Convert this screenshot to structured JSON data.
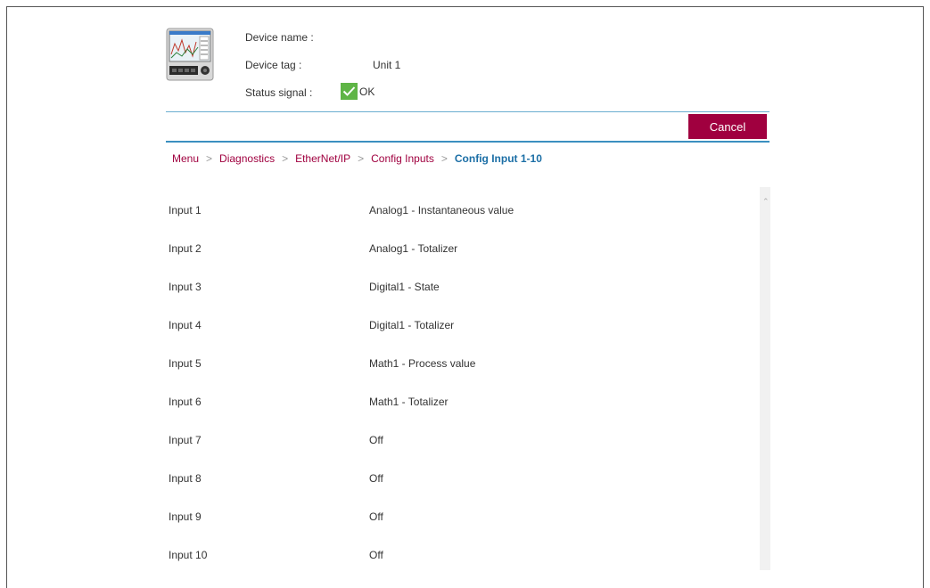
{
  "device": {
    "name_label": "Device name :",
    "name_value": "",
    "tag_label": "Device tag :",
    "tag_value": "Unit 1",
    "status_label": "Status signal :",
    "status_value": "OK",
    "status_color": "#5fb546"
  },
  "toolbar": {
    "cancel_label": "Cancel",
    "cancel_color": "#a0003f"
  },
  "breadcrumb": {
    "items": [
      "Menu",
      "Diagnostics",
      "EtherNet/IP",
      "Config Inputs"
    ],
    "separator": ">",
    "current": "Config Input 1-10"
  },
  "inputs": [
    {
      "label": "Input 1",
      "value": "Analog1 - Instantaneous value"
    },
    {
      "label": "Input 2",
      "value": "Analog1 - Totalizer"
    },
    {
      "label": "Input 3",
      "value": "Digital1 - State"
    },
    {
      "label": "Input 4",
      "value": "Digital1 - Totalizer"
    },
    {
      "label": "Input 5",
      "value": "Math1 - Process value"
    },
    {
      "label": "Input 6",
      "value": "Math1 - Totalizer"
    },
    {
      "label": "Input 7",
      "value": "Off"
    },
    {
      "label": "Input 8",
      "value": "Off"
    },
    {
      "label": "Input 9",
      "value": "Off"
    },
    {
      "label": "Input 10",
      "value": "Off"
    }
  ],
  "icons": {
    "device": "device-image-icon",
    "status": "checkmark-icon",
    "scroll_up": "scroll-up-arrow-icon"
  }
}
